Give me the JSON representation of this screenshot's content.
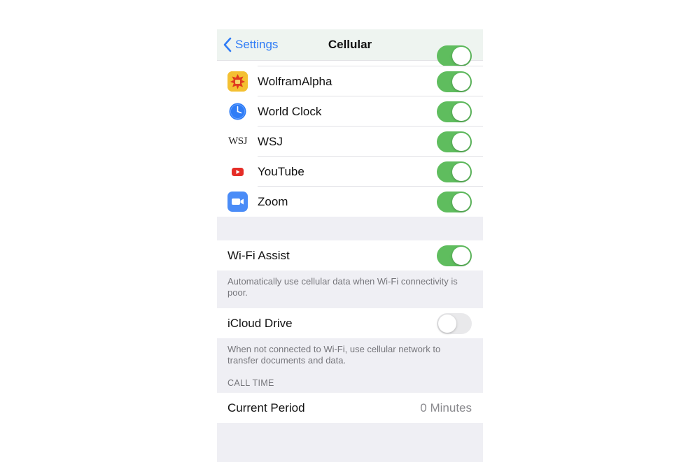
{
  "nav": {
    "back_label": "Settings",
    "title": "Cellular"
  },
  "apps": [
    {
      "name": "WolframAlpha",
      "icon": "wolframalpha-icon",
      "enabled": true
    },
    {
      "name": "World Clock",
      "icon": "world-clock-icon",
      "enabled": true
    },
    {
      "name": "WSJ",
      "icon": "wsj-icon",
      "icon_text": "WSJ",
      "enabled": true
    },
    {
      "name": "YouTube",
      "icon": "youtube-icon",
      "enabled": true
    },
    {
      "name": "Zoom",
      "icon": "zoom-icon",
      "enabled": true
    }
  ],
  "wifi_assist": {
    "label": "Wi-Fi Assist",
    "enabled": true,
    "footnote": "Automatically use cellular data when Wi-Fi connectivity is poor."
  },
  "icloud_drive": {
    "label": "iCloud Drive",
    "enabled": false,
    "footnote": "When not connected to Wi-Fi, use cellular network to transfer documents and data."
  },
  "call_time": {
    "header": "CALL TIME",
    "current_period_label": "Current Period",
    "current_period_value": "0 Minutes"
  },
  "colors": {
    "accent_blue": "#2f7cf6",
    "toggle_on": "#5fbd5e",
    "toggle_off": "#e9e9eb",
    "youtube_red": "#e52d27",
    "zoom_blue": "#4a8cf7"
  }
}
